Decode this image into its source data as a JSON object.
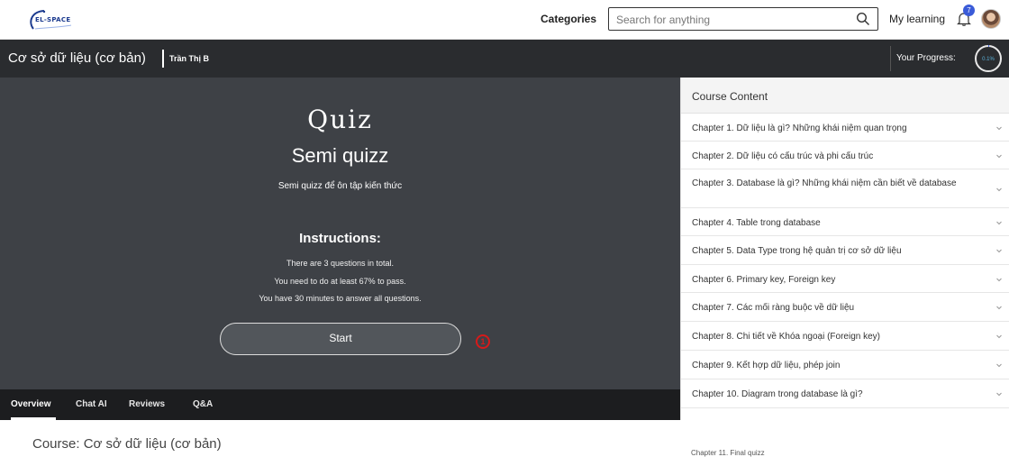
{
  "header": {
    "logo_text": "EL-SPACE",
    "categories_label": "Categories",
    "search_placeholder": "Search for anything",
    "my_learning_label": "My learning",
    "notification_count": "7",
    "accent_color": "#3a5bd8"
  },
  "course": {
    "title": "Cơ sở dữ liệu (cơ bản)",
    "author": "Trần Thị B",
    "progress_label": "Your Progress:",
    "progress_value": "0.1%"
  },
  "quiz": {
    "heading": "Quiz",
    "name": "Semi quizz",
    "description": "Semi quizz để ôn tập kiến thức",
    "instructions_title": "Instructions:",
    "instructions": [
      "There are 3 questions in total.",
      "You need to do at least 67% to pass.",
      "You have 30 minutes to answer all questions."
    ],
    "start_label": "Start",
    "marker_number": "1"
  },
  "tabs": [
    {
      "label": "Overview",
      "active": true
    },
    {
      "label": "Chat AI"
    },
    {
      "label": "Reviews"
    },
    {
      "label": "Q&A"
    }
  ],
  "overview": {
    "course_heading": "Course: Cơ sở dữ liệu (cơ bản)"
  },
  "sidebar": {
    "title": "Course Content",
    "chapters": [
      "Chapter 1. Dữ liệu là gì? Những khái niệm quan trọng",
      "Chapter 2. Dữ liệu có cấu trúc và phi cấu trúc",
      "Chapter 3. Database là gì? Những khái niệm cần biết về database",
      "Chapter 4. Table trong database",
      "Chapter 5. Data Type trong hệ quản trị cơ sở dữ liệu",
      "Chapter 6. Primary key, Foreign key",
      "Chapter 7. Các mối ràng buộc về dữ liệu",
      "Chapter 8. Chi tiết về Khóa ngoại (Foreign key)",
      "Chapter 9. Kết hợp dữ liệu, phép join",
      "Chapter 10. Diagram trong database là gì?"
    ],
    "peek_chapter": "Chapter 11. Final quizz"
  }
}
